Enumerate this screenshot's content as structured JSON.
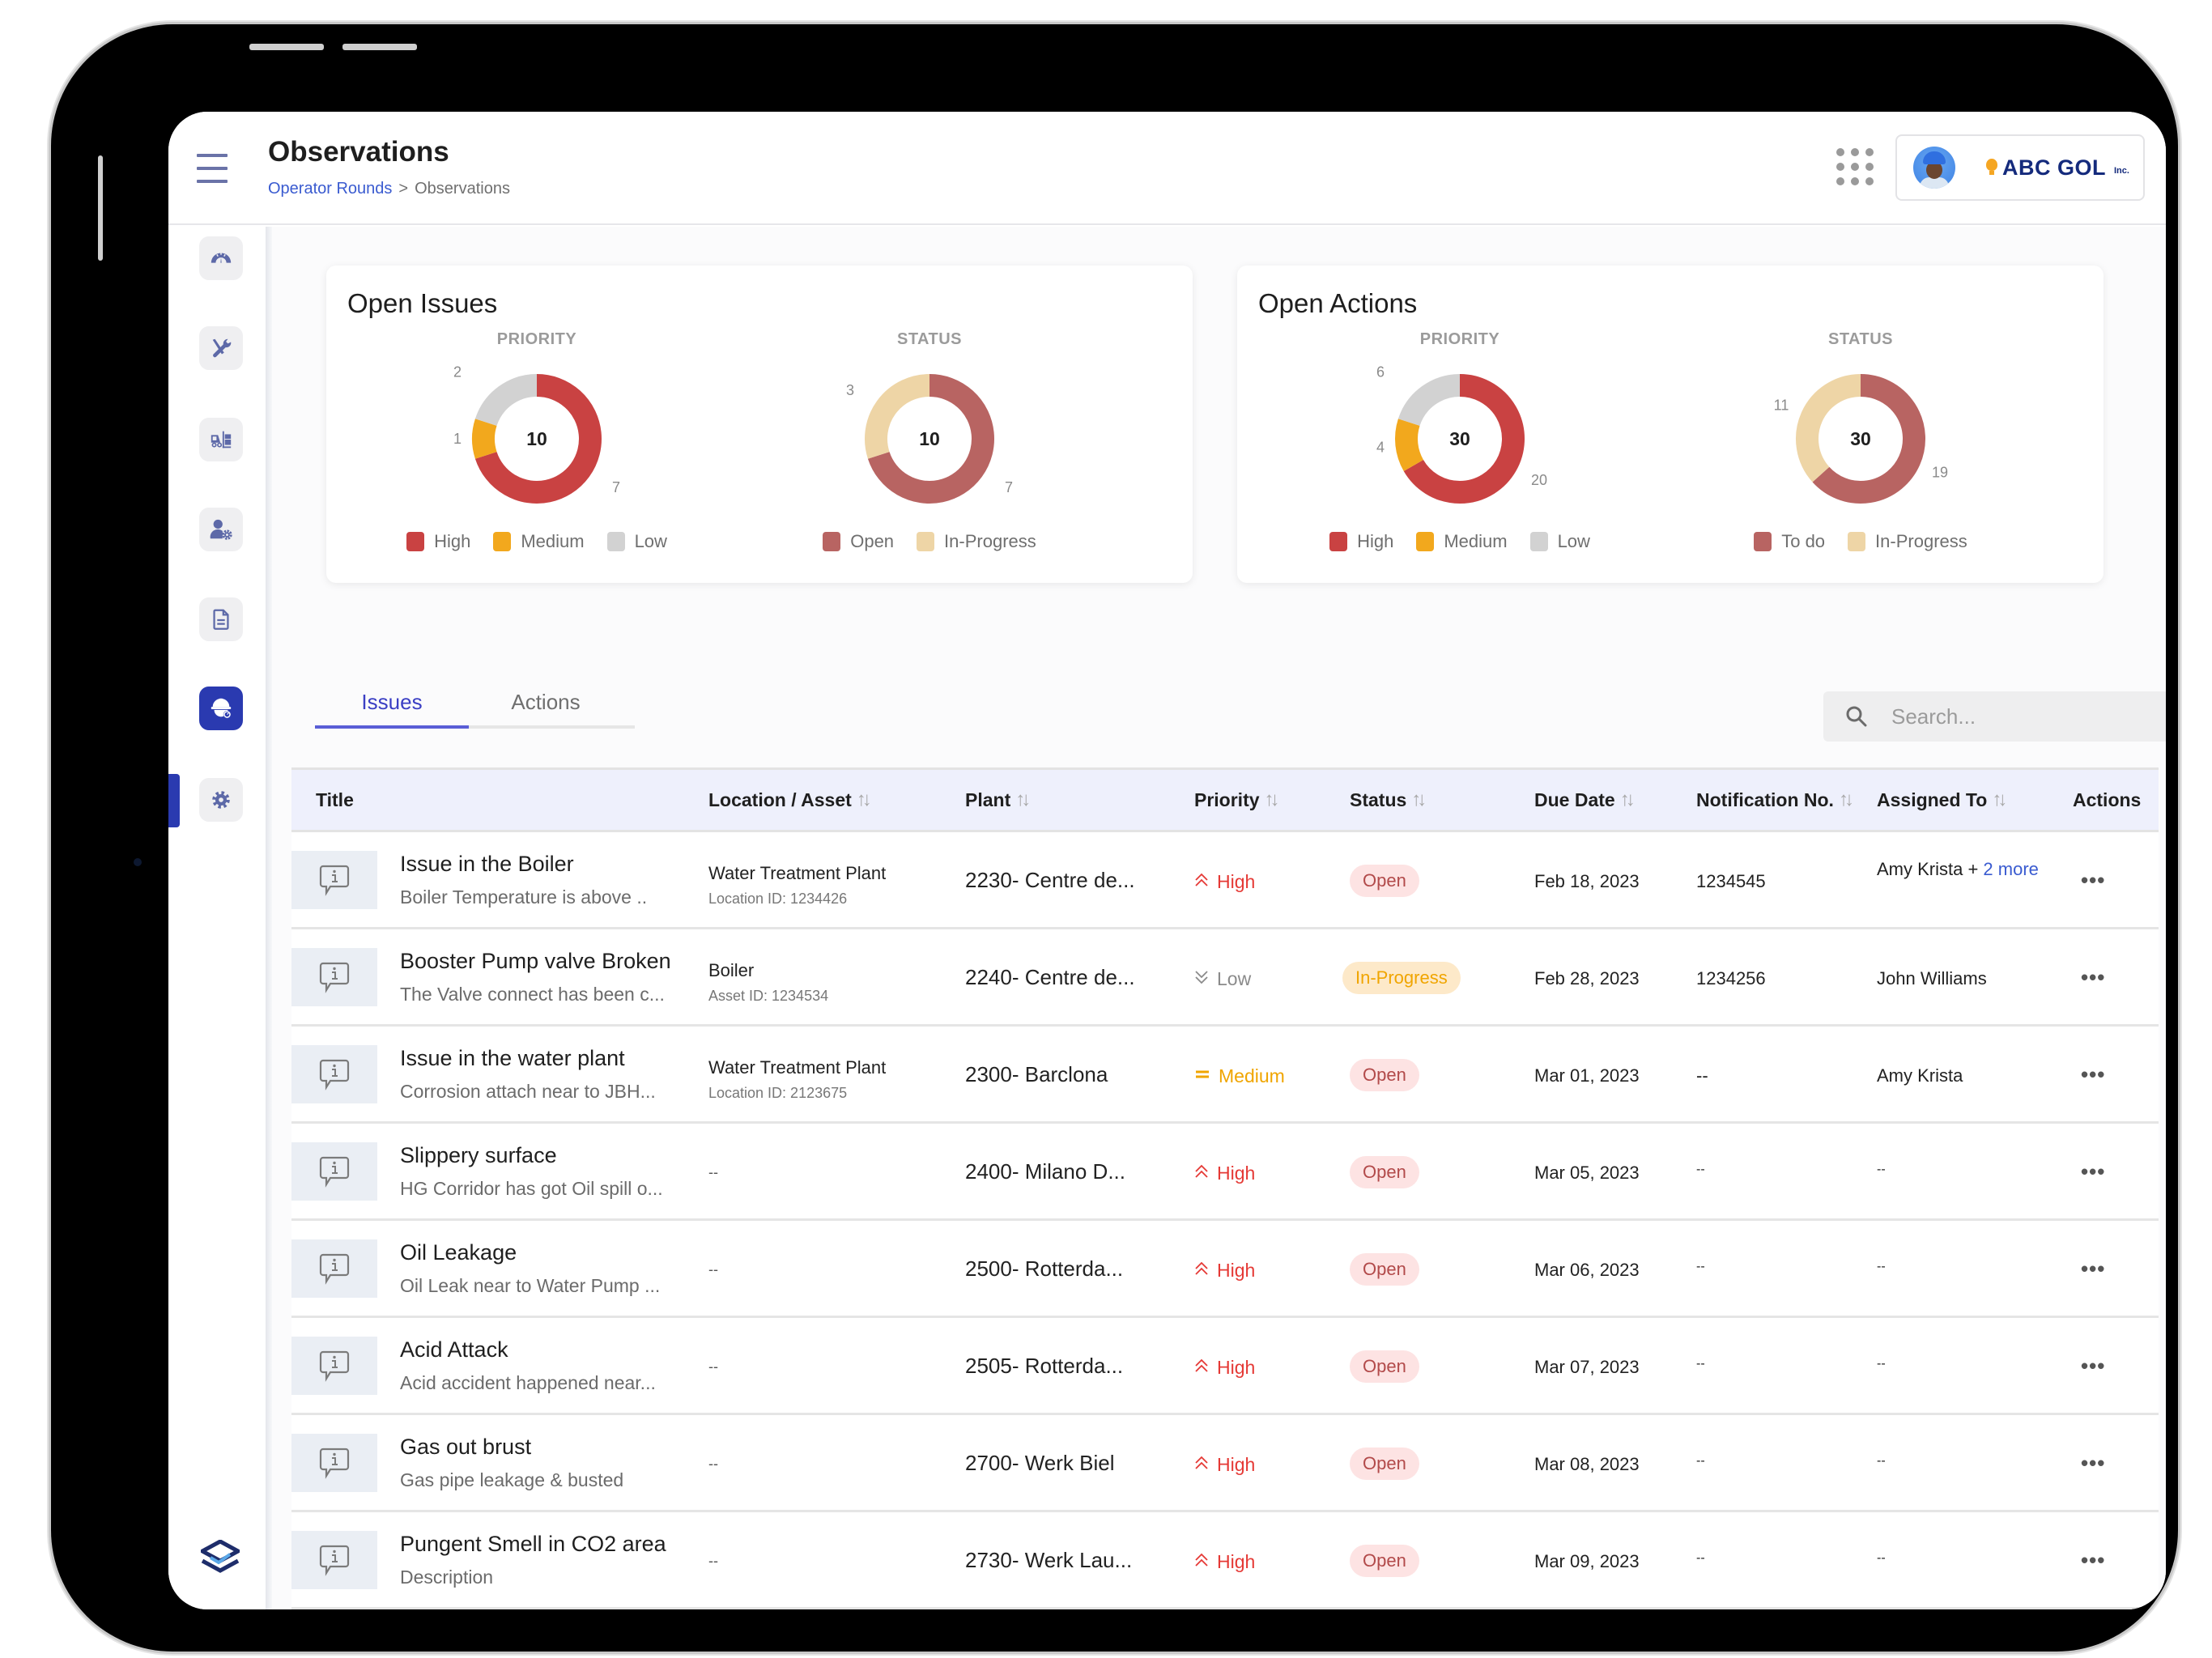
{
  "header": {
    "title": "Observations",
    "breadcrumb": [
      {
        "label": "Operator Rounds"
      },
      {
        "label": "Observations"
      }
    ],
    "breadcrumb_separator": ">",
    "brand": {
      "name": "ABC GOL",
      "suffix": "Inc."
    }
  },
  "sidebar": {
    "items": [
      {
        "name": "dashboard",
        "icon": "speedometer-icon",
        "active": false
      },
      {
        "name": "maintenance",
        "icon": "tools-icon",
        "active": false
      },
      {
        "name": "inventory",
        "icon": "forklift-icon",
        "active": false
      },
      {
        "name": "user-settings",
        "icon": "user-gear-icon",
        "active": false
      },
      {
        "name": "documents",
        "icon": "document-icon",
        "active": false
      },
      {
        "name": "observations",
        "icon": "safety-helmet-icon",
        "active": true
      },
      {
        "name": "settings",
        "icon": "gear-icon",
        "active": false
      }
    ]
  },
  "cards": {
    "open_issues": {
      "title": "Open Issues"
    },
    "open_actions": {
      "title": "Open Actions"
    }
  },
  "chart_data": [
    {
      "type": "pie",
      "variant": "donut",
      "group": "Open Issues",
      "title": "PRIORITY",
      "total": 10,
      "categories": [
        "High",
        "Medium",
        "Low"
      ],
      "values": [
        7,
        1,
        2
      ],
      "colors": [
        "#c94242",
        "#f2a81d",
        "#d2d2d2"
      ]
    },
    {
      "type": "pie",
      "variant": "donut",
      "group": "Open Issues",
      "title": "STATUS",
      "total": 10,
      "categories": [
        "Open",
        "In-Progress"
      ],
      "values": [
        7,
        3
      ],
      "colors": [
        "#b86462",
        "#eed5a6"
      ]
    },
    {
      "type": "pie",
      "variant": "donut",
      "group": "Open Actions",
      "title": "PRIORITY",
      "total": 30,
      "categories": [
        "High",
        "Medium",
        "Low"
      ],
      "values": [
        20,
        4,
        6
      ],
      "colors": [
        "#c94242",
        "#f2a81d",
        "#d2d2d2"
      ]
    },
    {
      "type": "pie",
      "variant": "donut",
      "group": "Open Actions",
      "title": "STATUS",
      "total": 30,
      "categories": [
        "To do",
        "In-Progress"
      ],
      "values": [
        19,
        11
      ],
      "colors": [
        "#b86462",
        "#eed5a6"
      ]
    }
  ],
  "tabs": [
    {
      "label": "Issues",
      "active": true
    },
    {
      "label": "Actions",
      "active": false
    }
  ],
  "search": {
    "placeholder": "Search...",
    "value": ""
  },
  "table": {
    "columns": [
      {
        "label": "Title",
        "sortable": false
      },
      {
        "label": "Location / Asset",
        "sortable": true
      },
      {
        "label": "Plant",
        "sortable": true
      },
      {
        "label": "Priority",
        "sortable": true
      },
      {
        "label": "Status",
        "sortable": true
      },
      {
        "label": "Due Date",
        "sortable": true
      },
      {
        "label": "Notification No.",
        "sortable": true
      },
      {
        "label": "Assigned To",
        "sortable": true
      },
      {
        "label": "Actions",
        "sortable": false
      }
    ],
    "rows": [
      {
        "title": "Issue in the Boiler",
        "description": "Boiler Temperature is above ..",
        "location": "Water Treatment Plant",
        "location_sub": "Location ID: 1234426",
        "plant": "2230- Centre de...",
        "priority": "High",
        "status": "Open",
        "due_date": "Feb 18, 2023",
        "notification": "1234545",
        "assigned": "Amy Krista + ",
        "assigned_more": "2 more"
      },
      {
        "title": "Booster Pump valve Broken",
        "description": "The Valve connect has been c...",
        "location": "Boiler",
        "location_sub": "Asset ID: 1234534",
        "plant": "2240- Centre de...",
        "priority": "Low",
        "status": "In-Progress",
        "due_date": "Feb 28, 2023",
        "notification": "1234256",
        "assigned": "John Williams",
        "assigned_more": ""
      },
      {
        "title": "Issue in the water plant",
        "description": "Corrosion attach near to JBH...",
        "location": "Water Treatment Plant",
        "location_sub": "Location ID: 2123675",
        "plant": "2300- Barclona",
        "priority": "Medium",
        "status": "Open",
        "due_date": "Mar 01, 2023",
        "notification": "--",
        "assigned": "Amy Krista",
        "assigned_more": ""
      },
      {
        "title": "Slippery surface",
        "description": "HG Corridor has got Oil spill o...",
        "location": "--",
        "location_sub": "",
        "plant": "2400-  Milano D...",
        "priority": "High",
        "status": "Open",
        "due_date": "Mar 05, 2023",
        "notification": "--",
        "assigned": "--",
        "assigned_more": ""
      },
      {
        "title": "Oil Leakage",
        "description": "Oil Leak near to Water Pump ...",
        "location": "--",
        "location_sub": "",
        "plant": "2500- Rotterda...",
        "priority": "High",
        "status": "Open",
        "due_date": "Mar 06, 2023",
        "notification": "--",
        "assigned": "--",
        "assigned_more": ""
      },
      {
        "title": "Acid Attack",
        "description": "Acid accident happened near...",
        "location": "--",
        "location_sub": "",
        "plant": "2505- Rotterda...",
        "priority": "High",
        "status": "Open",
        "due_date": "Mar 07, 2023",
        "notification": "--",
        "assigned": "--",
        "assigned_more": ""
      },
      {
        "title": "Gas out brust",
        "description": "Gas pipe leakage & busted",
        "location": "--",
        "location_sub": "",
        "plant": "2700- Werk Biel",
        "priority": "High",
        "status": "Open",
        "due_date": "Mar 08, 2023",
        "notification": "--",
        "assigned": "--",
        "assigned_more": ""
      },
      {
        "title": "Pungent Smell in CO2 area",
        "description": "Description",
        "location": "--",
        "location_sub": "",
        "plant": "2730- Werk Lau...",
        "priority": "High",
        "status": "Open",
        "due_date": "Mar 09, 2023",
        "notification": "--",
        "assigned": "--",
        "assigned_more": ""
      }
    ],
    "row_menu_glyph": "•••"
  },
  "priority_styles": {
    "High": {
      "icon": "double-chevron-up-icon",
      "glyph": "⌃",
      "color": "#e53935"
    },
    "Medium": {
      "icon": "equals-icon",
      "glyph": "=",
      "color": "#f0a500"
    },
    "Low": {
      "icon": "double-chevron-down-icon",
      "glyph": "⌄",
      "color": "#8a8a8a"
    }
  },
  "status_styles": {
    "Open": {
      "bg": "#fde3e3",
      "color": "#b24a4a"
    },
    "In-Progress": {
      "bg": "#fde9c9",
      "color": "#f0a500"
    }
  },
  "colors": {
    "accent": "#2a3ab0",
    "link": "#3a5bd0",
    "tab_active": "#3b3fc4"
  }
}
